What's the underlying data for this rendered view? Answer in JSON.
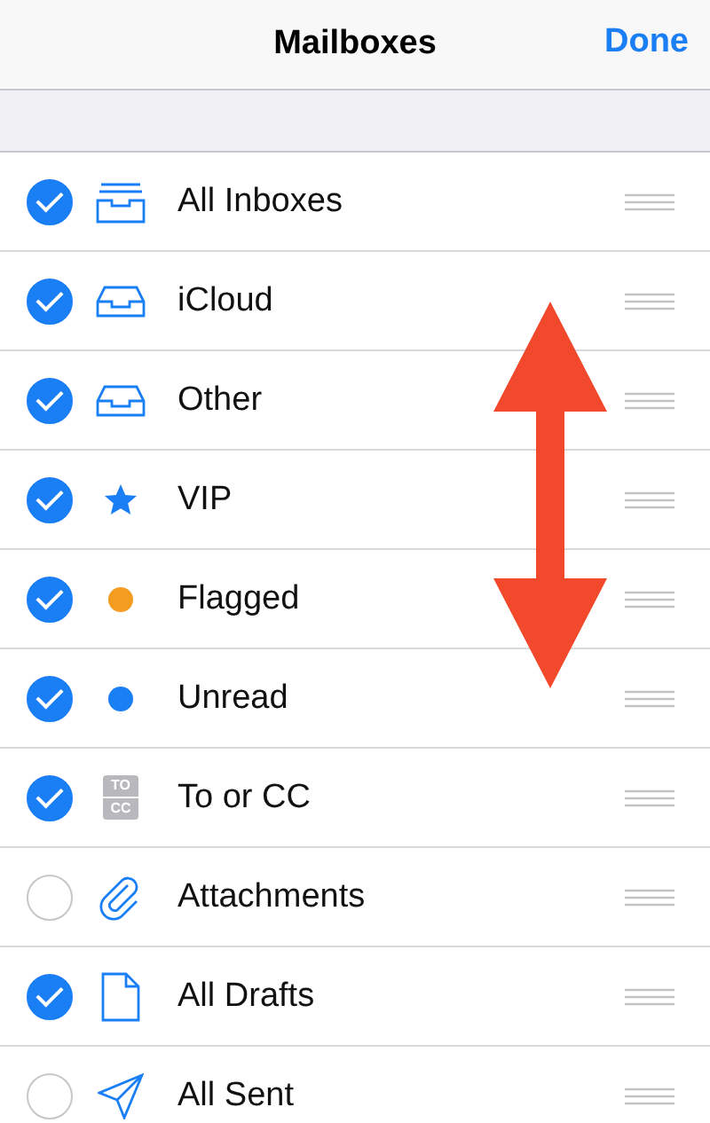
{
  "nav_bar": {
    "title": "Mailboxes",
    "done": "Done"
  },
  "mailboxes": [
    {
      "label": "All Inboxes",
      "checked": true,
      "kind": "inboxes"
    },
    {
      "label": "iCloud",
      "checked": true,
      "kind": "tray"
    },
    {
      "label": "Other",
      "checked": true,
      "kind": "tray"
    },
    {
      "label": "VIP",
      "checked": true,
      "kind": "star"
    },
    {
      "label": "Flagged",
      "checked": true,
      "kind": "dot",
      "color": "#f39c1f"
    },
    {
      "label": "Unread",
      "checked": true,
      "kind": "dot",
      "color": "#1a7ef5"
    },
    {
      "label": "To or CC",
      "checked": true,
      "kind": "badge",
      "badge_lines": [
        "TO",
        "CC"
      ]
    },
    {
      "label": "Attachments",
      "checked": false,
      "kind": "clip"
    },
    {
      "label": "All Drafts",
      "checked": true,
      "kind": "doc"
    },
    {
      "label": "All Sent",
      "checked": false,
      "kind": "plane"
    }
  ]
}
